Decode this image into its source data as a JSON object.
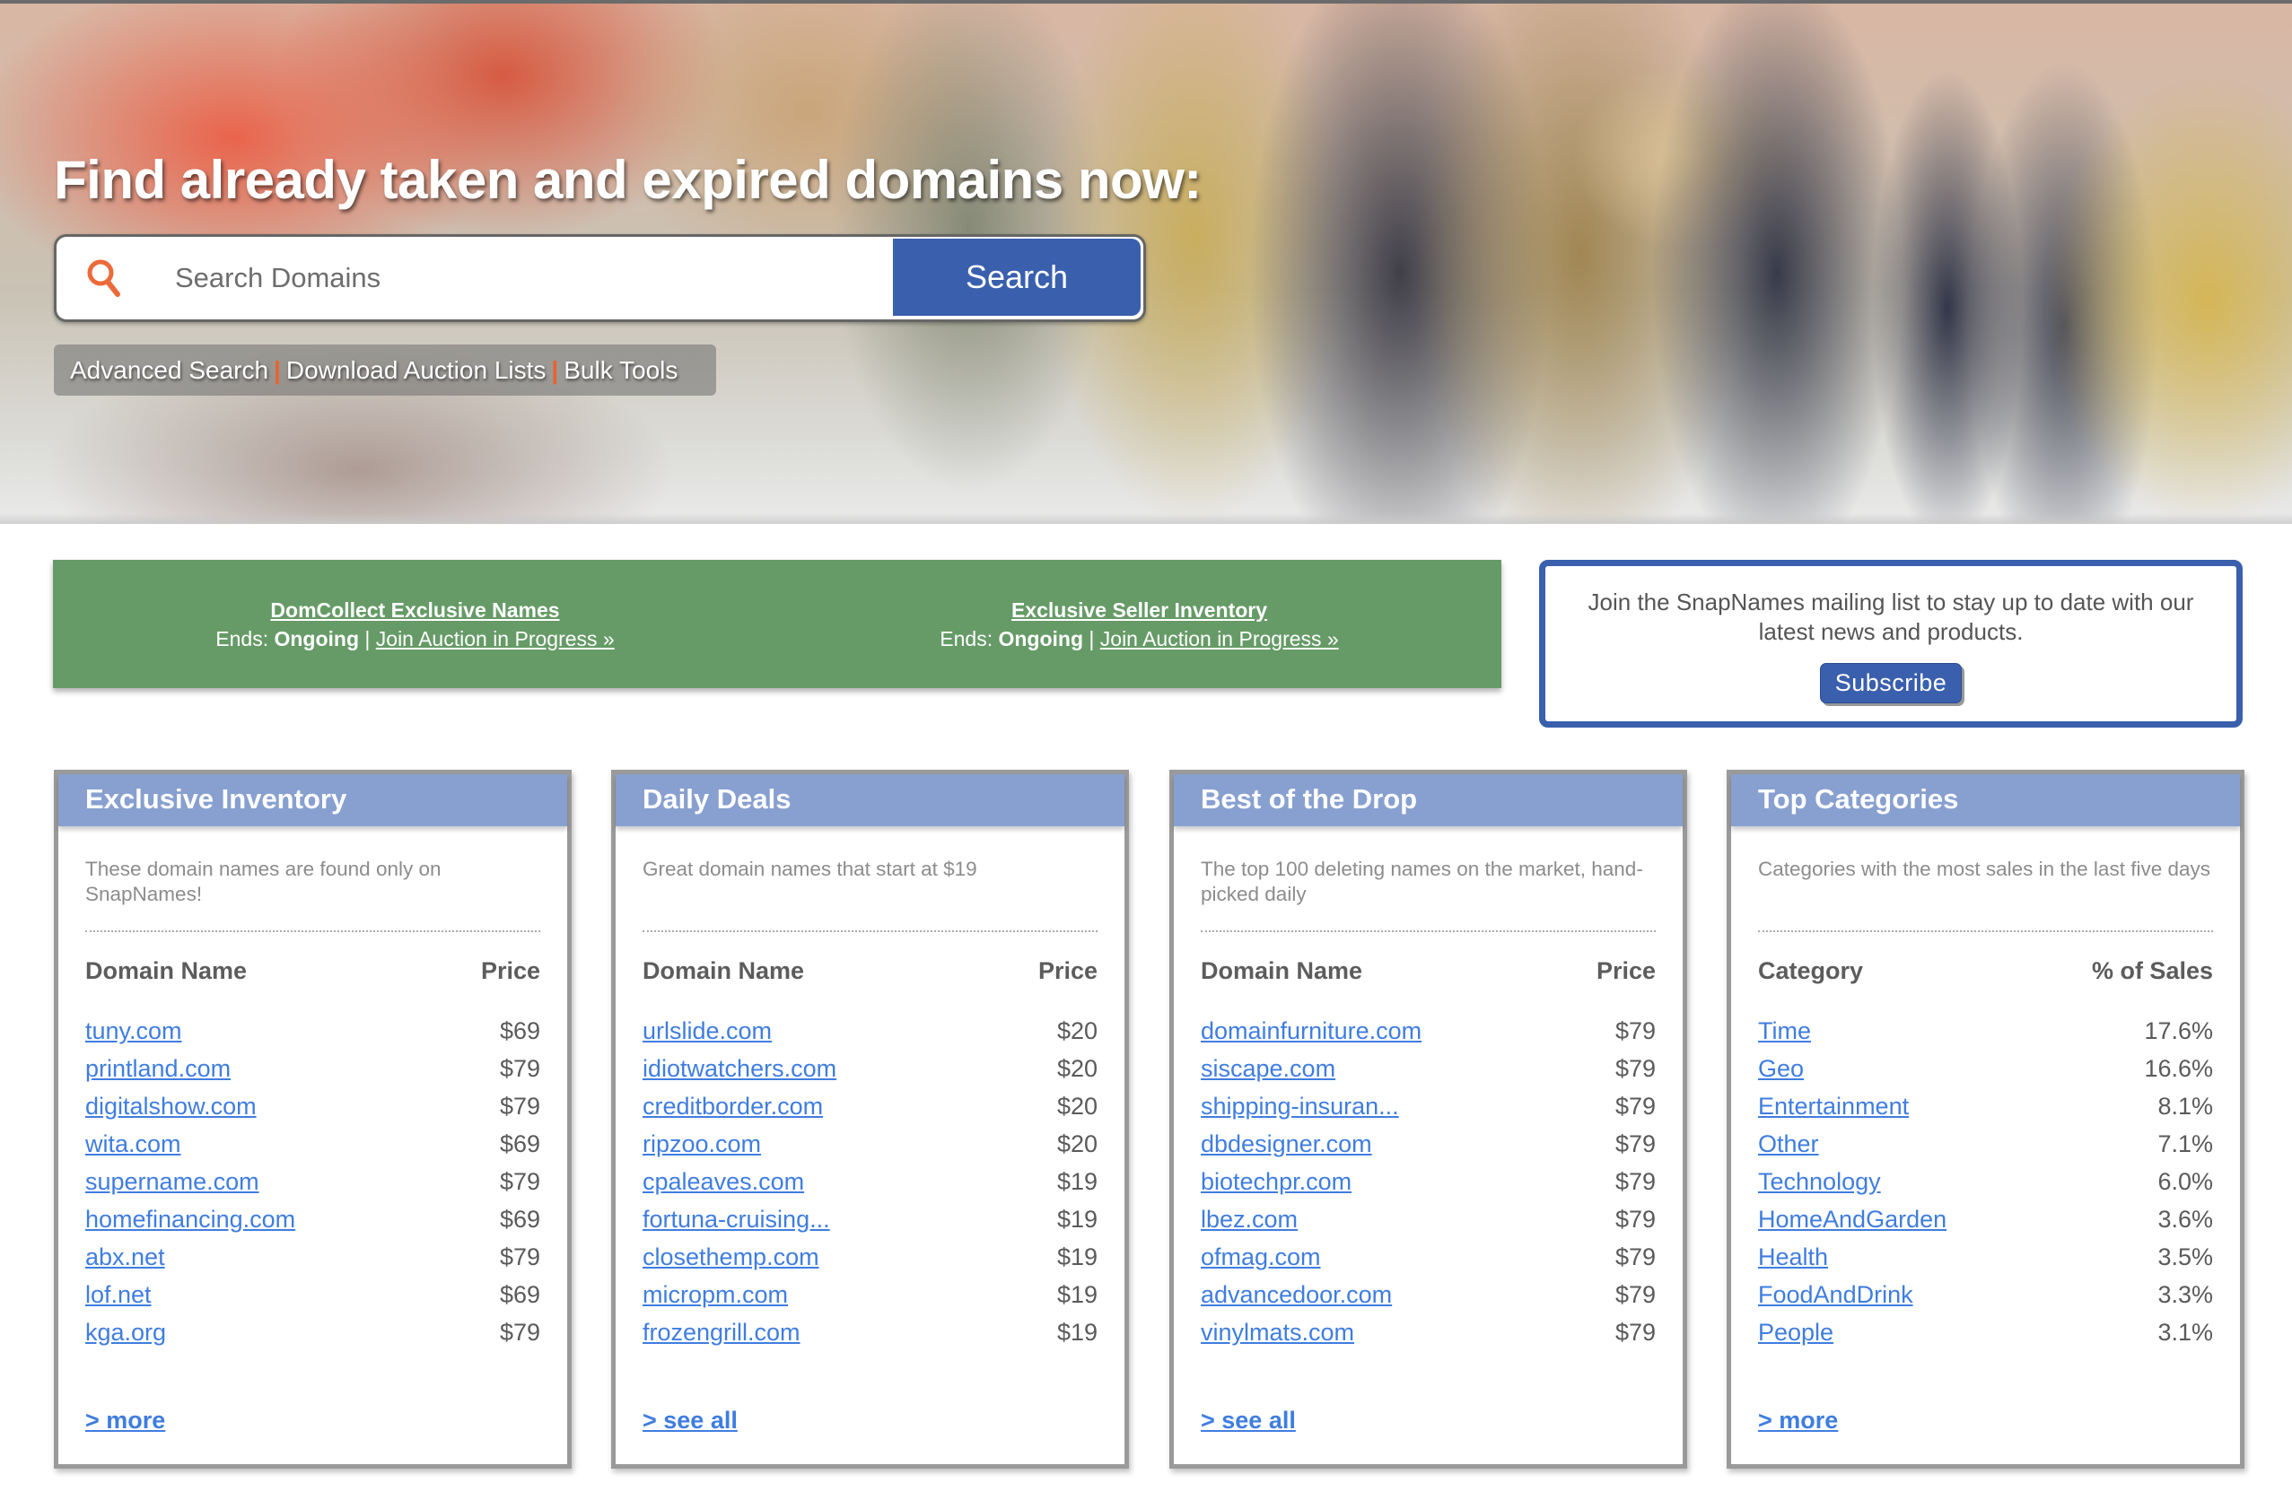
{
  "hero": {
    "title": "Find already taken and expired domains now:",
    "search": {
      "placeholder": "Search Domains",
      "value": "",
      "button_label": "Search",
      "icon": "search-icon"
    },
    "links": [
      {
        "label": "Advanced Search"
      },
      {
        "label": "Download Auction Lists"
      },
      {
        "label": "Bulk Tools"
      }
    ],
    "link_separator": "|"
  },
  "auctions": [
    {
      "name": "DomCollect Exclusive Names",
      "ends_label": "Ends:",
      "ends_value": "Ongoing",
      "separator": "|",
      "join_label": "Join Auction in Progress »"
    },
    {
      "name": "Exclusive Seller Inventory",
      "ends_label": "Ends:",
      "ends_value": "Ongoing",
      "separator": "|",
      "join_label": "Join Auction in Progress »"
    }
  ],
  "subscribe": {
    "text": "Join the SnapNames mailing list to stay up to date with our latest news and products.",
    "button_label": "Subscribe"
  },
  "cards": [
    {
      "title": "Exclusive Inventory",
      "description": "These domain names are found only on SnapNames!",
      "columns": [
        "Domain Name",
        "Price"
      ],
      "rows": [
        {
          "name": "tuny.com",
          "value": "$69"
        },
        {
          "name": "printland.com",
          "value": "$79"
        },
        {
          "name": "digitalshow.com",
          "value": "$79"
        },
        {
          "name": "wita.com",
          "value": "$69"
        },
        {
          "name": "supername.com",
          "value": "$79"
        },
        {
          "name": "homefinancing.com",
          "value": "$69"
        },
        {
          "name": "abx.net",
          "value": "$79"
        },
        {
          "name": "lof.net",
          "value": "$69"
        },
        {
          "name": "kga.org",
          "value": "$79"
        }
      ],
      "more_label": "> more"
    },
    {
      "title": "Daily Deals",
      "description": "Great domain names that start at $19",
      "columns": [
        "Domain Name",
        "Price"
      ],
      "rows": [
        {
          "name": "urlslide.com",
          "value": "$20"
        },
        {
          "name": "idiotwatchers.com",
          "value": "$20"
        },
        {
          "name": "creditborder.com",
          "value": "$20"
        },
        {
          "name": "ripzoo.com",
          "value": "$20"
        },
        {
          "name": "cpaleaves.com",
          "value": "$19"
        },
        {
          "name": "fortuna-cruising...",
          "value": "$19"
        },
        {
          "name": "closethemp.com",
          "value": "$19"
        },
        {
          "name": "micropm.com",
          "value": "$19"
        },
        {
          "name": "frozengrill.com",
          "value": "$19"
        }
      ],
      "more_label": "> see all"
    },
    {
      "title": "Best of the Drop",
      "description": "The top 100 deleting names on the market, hand-picked daily",
      "columns": [
        "Domain Name",
        "Price"
      ],
      "rows": [
        {
          "name": "domainfurniture.com",
          "value": "$79"
        },
        {
          "name": "siscape.com",
          "value": "$79"
        },
        {
          "name": "shipping-insuran...",
          "value": "$79"
        },
        {
          "name": "dbdesigner.com",
          "value": "$79"
        },
        {
          "name": "biotechpr.com",
          "value": "$79"
        },
        {
          "name": "lbez.com",
          "value": "$79"
        },
        {
          "name": "ofmag.com",
          "value": "$79"
        },
        {
          "name": "advancedoor.com",
          "value": "$79"
        },
        {
          "name": "vinylmats.com",
          "value": "$79"
        }
      ],
      "more_label": "> see all"
    },
    {
      "title": "Top Categories",
      "description": "Categories with the most sales in the last five days",
      "columns": [
        "Category",
        "% of Sales"
      ],
      "rows": [
        {
          "name": "Time",
          "value": "17.6%"
        },
        {
          "name": "Geo",
          "value": "16.6%"
        },
        {
          "name": "Entertainment",
          "value": "8.1%"
        },
        {
          "name": "Other",
          "value": "7.1%"
        },
        {
          "name": "Technology",
          "value": "6.0%"
        },
        {
          "name": "HomeAndGarden",
          "value": "3.6%"
        },
        {
          "name": "Health",
          "value": "3.5%"
        },
        {
          "name": "FoodAndDrink",
          "value": "3.3%"
        },
        {
          "name": "People",
          "value": "3.1%"
        }
      ],
      "more_label": "> more"
    }
  ],
  "colors": {
    "brand_blue": "#3a5fad",
    "card_header": "#88a0d0",
    "banner_green": "#669b67",
    "link_blue": "#3f7de0",
    "accent_orange": "#e8632e"
  }
}
